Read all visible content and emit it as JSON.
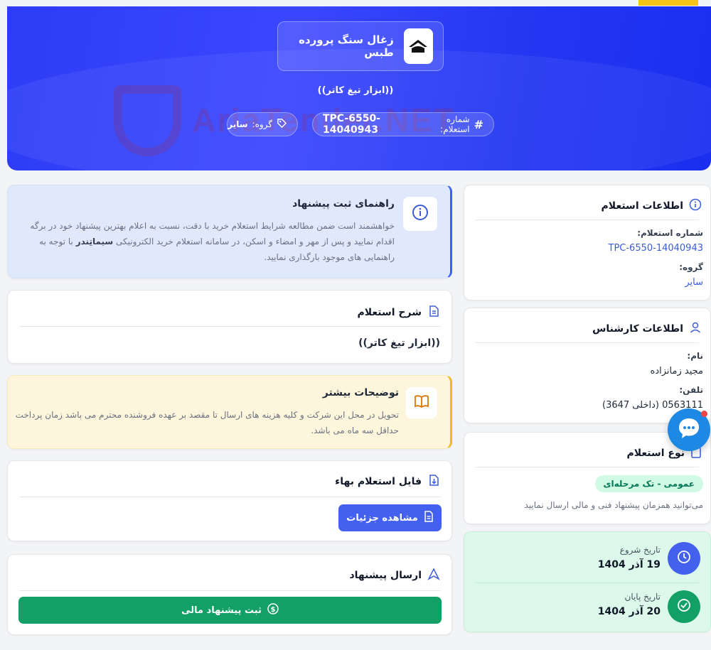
{
  "header": {
    "company_name": "زغال سنگ پرورده طبس",
    "subtitle": "((ابزار تیغ کاتر))",
    "inquiry_number_label": "شماره استعلام:",
    "inquiry_number": "TPC-6550-14040943",
    "group_label": "گروه:",
    "group_value": "سایر",
    "watermark_text": "AriaTender.NET"
  },
  "guide": {
    "title": "راهنمای ثبت پیشنهاد",
    "text_part1": "خواهشمند است ضمن مطالعه شرایط استعلام خرید با دقت، نسبت به اعلام بهترین پیشنهاد خود در برگه اقدام نمایید و پس از مهر و امضاء و اسکن، در سامانه استعلام خرید الکترونیکی",
    "text_brand": "سیماتِندر",
    "text_part2": "با توجه به راهنمایی های موجود بارگذاری نمایید."
  },
  "description": {
    "title": "شرح استعلام",
    "text": "((ابزار تیغ کاتر))"
  },
  "more_info": {
    "title": "توضیحات بیشتر",
    "text": "تحویل در محل این شرکت و کلیه هزینه های ارسال تا مقصد بر عهده فروشنده محترم می باشد زمان پرداخت حداقل سه ماه می باشد."
  },
  "file": {
    "title": "فایل استعلام بهاء",
    "button_label": "مشاهده جزئیات"
  },
  "submit": {
    "title": "ارسال پیشنهاد",
    "button_label": "ثبت پیشنهاد مالی"
  },
  "inquiry_info": {
    "title": "اطلاعات استعلام",
    "number_label": "شماره استعلام:",
    "number_value": "TPC-6550-14040943",
    "group_label": "گروه:",
    "group_value": "سایر"
  },
  "expert_info": {
    "title": "اطلاعات کارشناس",
    "name_label": "نام:",
    "name_value": "مجید زمانزاده",
    "phone_label": "تلفن:",
    "phone_value": "0563111 (داخلی 3647)"
  },
  "inquiry_type": {
    "title": "نوع استعلام",
    "badge": "عمومی - تک مرحله‌ای",
    "text": "می‌توانید همزمان پیشنهاد فنی و مالی ارسال نمایید"
  },
  "dates": {
    "start_label": "تاریخ شروع",
    "start_value": "19 آذر 1404",
    "end_label": "تاریخ پایان",
    "end_value": "20 آذر 1404"
  },
  "colors": {
    "hero": "#2d3df5",
    "primary_button": "#4361ee",
    "success_button": "#12a067",
    "link": "#3b5bdb"
  }
}
